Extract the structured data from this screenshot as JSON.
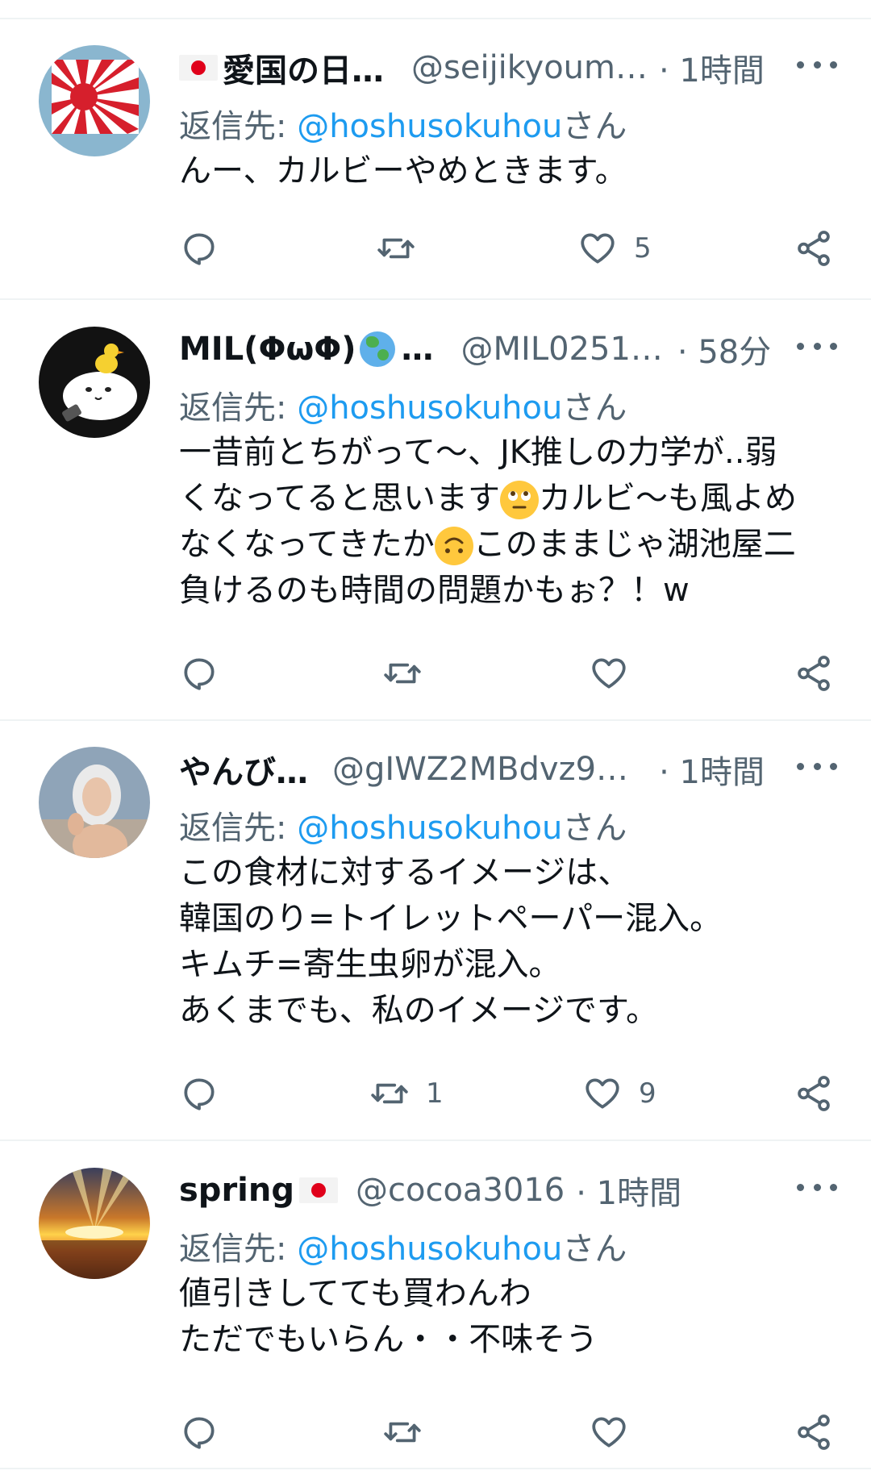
{
  "tweets": [
    {
      "name": "愛国の日…",
      "handle": "@seijikyoum…",
      "time": "· 1時間",
      "reply_prefix": "返信先: ",
      "reply_mention": "@hoshusokuhou",
      "reply_suffix": "さん",
      "text": "んー、カルビーやめときます。",
      "retweets": "",
      "likes": "5"
    },
    {
      "name": "MIL(ΦωΦ)",
      "name_suffix": "…",
      "handle": "@MIL0251…",
      "time": "· 58分",
      "reply_prefix": "返信先: ",
      "reply_mention": "@hoshusokuhou",
      "reply_suffix": "さん",
      "text_part1": "一昔前とちがって〜、JK推しの力学が..弱\nくなってると思います",
      "text_part2": "カルビ〜も風よめ\nなくなってきたか",
      "text_part3": "このままじゃ湖池屋二\n負けるのも時間の問題かもぉ？！w",
      "retweets": "",
      "likes": ""
    },
    {
      "name": "やんび…",
      "handle": "@gIWZ2MBdvz9…",
      "time": "· 1時間",
      "reply_prefix": "返信先: ",
      "reply_mention": "@hoshusokuhou",
      "reply_suffix": "さん",
      "text": "この食材に対するイメージは、\n韓国のり=トイレットペーパー混入。\nキムチ=寄生虫卵が混入。\nあくまでも、私のイメージです。",
      "retweets": "1",
      "likes": "9"
    },
    {
      "name": "spring",
      "handle": "@cocoa3016",
      "time": "· 1時間",
      "reply_prefix": "返信先: ",
      "reply_mention": "@hoshusokuhou",
      "reply_suffix": "さん",
      "text": "値引きしてても買わんわ\nただでもいらん・・不味そう",
      "retweets": "",
      "likes": ""
    }
  ],
  "icons": {
    "reply": "reply-icon",
    "retweet": "retweet-icon",
    "like": "heart-icon",
    "share": "share-icon",
    "more": "more-icon"
  },
  "colors": {
    "text": "#0f1419",
    "secondary": "#536471",
    "link": "#1d9bf0",
    "divider": "#eff3f4"
  }
}
